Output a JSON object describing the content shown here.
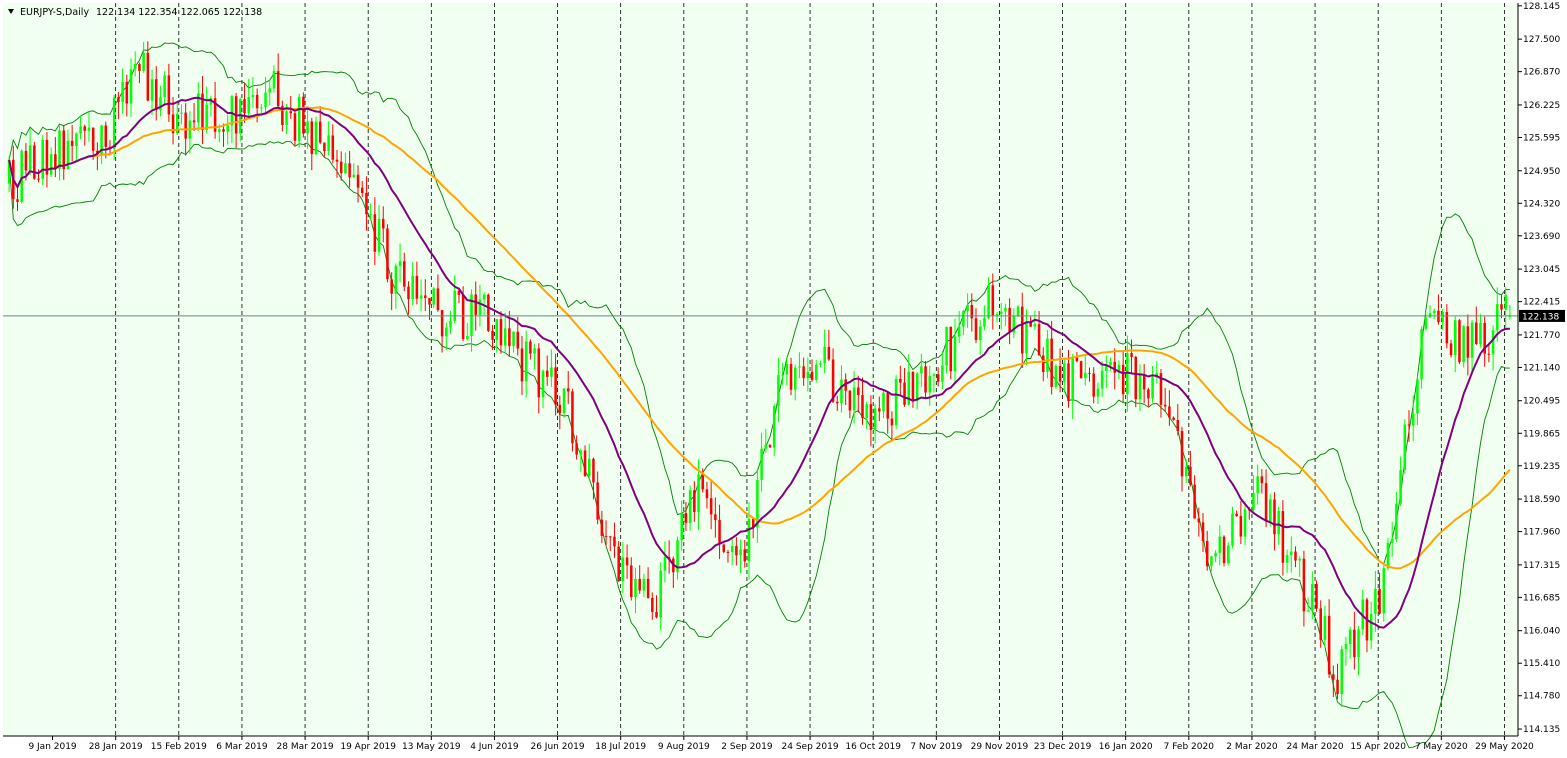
{
  "header": {
    "symbol_label": "EURJPY-S,Daily",
    "ohlc_label": "122.134 122.354 122.065 122.138"
  },
  "colors": {
    "background": "#f0fff0",
    "bull_candle": "#00ff00",
    "bear_candle": "#ff0000",
    "ma_fast": "#800080",
    "ma_slow": "#ffa500",
    "bollinger": "#008000",
    "current_price_line": "#708090",
    "price_tag_bg": "#000000",
    "price_tag_text": "#ffffff",
    "grid_line": "#000000"
  },
  "chart_data": {
    "type": "candlestick",
    "symbol": "EURJPY-S",
    "timeframe": "Daily",
    "last_bar": {
      "open": 122.134,
      "high": 122.354,
      "low": 122.065,
      "close": 122.138
    },
    "current_price_label": "122.138",
    "current_price": 122.138,
    "y_range": [
      114.0,
      128.2
    ],
    "y_ticks": [
      "128.145",
      "127.500",
      "126.870",
      "126.225",
      "125.595",
      "124.950",
      "124.320",
      "123.690",
      "123.045",
      "122.415",
      "121.770",
      "121.140",
      "120.495",
      "119.865",
      "119.235",
      "118.590",
      "117.960",
      "117.315",
      "116.685",
      "116.040",
      "115.410",
      "114.780",
      "114.135"
    ],
    "x_labels": [
      "9 Jan 2019",
      "28 Jan 2019",
      "15 Feb 2019",
      "6 Mar 2019",
      "28 Mar 2019",
      "19 Apr 2019",
      "13 May 2019",
      "4 Jun 2019",
      "26 Jun 2019",
      "18 Jul 2019",
      "9 Aug 2019",
      "2 Sep 2019",
      "24 Sep 2019",
      "16 Oct 2019",
      "7 Nov 2019",
      "29 Nov 2019",
      "23 Dec 2019",
      "16 Jan 2020",
      "7 Feb 2020",
      "2 Mar 2020",
      "24 Mar 2020",
      "15 Apr 2020",
      "7 May 2020",
      "29 May 2020"
    ],
    "price_path": [
      124.7,
      125.4,
      125.3,
      126.9,
      126.0,
      125.9,
      126.6,
      125.7,
      124.6,
      122.9,
      122.1,
      122.2,
      121.3,
      120.3,
      117.8,
      116.3,
      118.8,
      117.2,
      120.8,
      121.2,
      120.1,
      120.6,
      121.6,
      122.5,
      121.4,
      120.8,
      121.0,
      120.4,
      117.1,
      118.8,
      117.3,
      115.2,
      116.9,
      121.8,
      121.6,
      122.1
    ],
    "indicators": [
      {
        "type": "moving_average",
        "color_key": "ma_fast"
      },
      {
        "type": "moving_average",
        "color_key": "ma_slow"
      },
      {
        "type": "bollinger_bands",
        "color_key": "bollinger"
      }
    ]
  }
}
